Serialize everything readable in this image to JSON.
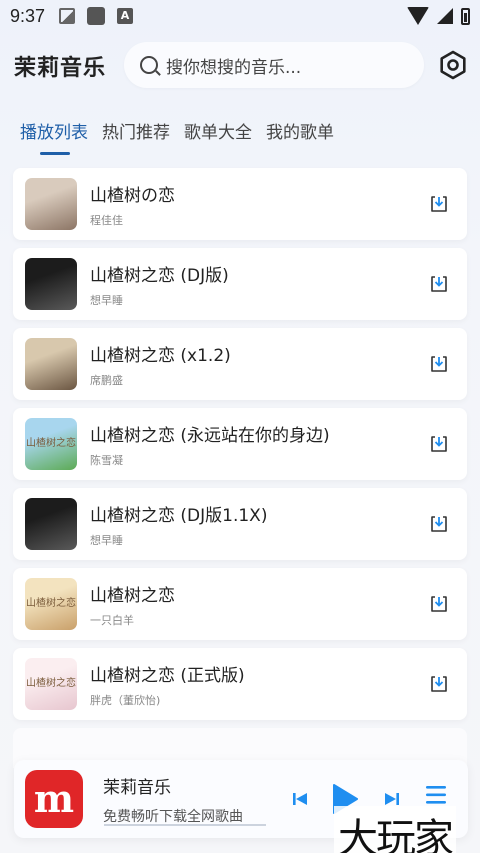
{
  "status_bar": {
    "time": "9:37",
    "notification_letter": "A"
  },
  "header": {
    "app_title": "茉莉音乐",
    "search_placeholder": "搜你想搜的音乐..."
  },
  "tabs": [
    {
      "label": "播放列表",
      "active": true
    },
    {
      "label": "热门推荐",
      "active": false
    },
    {
      "label": "歌单大全",
      "active": false
    },
    {
      "label": "我的歌单",
      "active": false
    }
  ],
  "songs": [
    {
      "title": "山楂树の恋",
      "artist": "程佳佳",
      "cover_colors": [
        "#d9cbbd",
        "#8c7565"
      ],
      "cover_text": ""
    },
    {
      "title": "山楂树之恋 (DJ版)",
      "artist": "想早睡",
      "cover_colors": [
        "#1c1c1c",
        "#5a5a5a"
      ],
      "cover_text": ""
    },
    {
      "title": "山楂树之恋 (x1.2)",
      "artist": "席鹏盛",
      "cover_colors": [
        "#d8c8ad",
        "#6b5642"
      ],
      "cover_text": ""
    },
    {
      "title": "山楂树之恋 (永远站在你的身边)",
      "artist": "陈雪凝",
      "cover_colors": [
        "#a8d6ee",
        "#5caa54"
      ],
      "cover_text": "山楂树之恋"
    },
    {
      "title": "山楂树之恋 (DJ版1.1X)",
      "artist": "想早睡",
      "cover_colors": [
        "#1c1c1c",
        "#5a5a5a"
      ],
      "cover_text": ""
    },
    {
      "title": "山楂树之恋",
      "artist": "一只白羊",
      "cover_colors": [
        "#f3e3bf",
        "#c9a06a"
      ],
      "cover_text": "山楂树之恋"
    },
    {
      "title": "山楂树之恋 (正式版)",
      "artist": "胖虎（董欣怡)",
      "cover_colors": [
        "#fbeef0",
        "#e7c6cf"
      ],
      "cover_text": "山楂树之恋"
    }
  ],
  "player": {
    "title": "茉莉音乐",
    "subtitle": "免费畅听下载全网歌曲",
    "progress": 0.0,
    "logo_letter": "m"
  },
  "watermark": "大玩家",
  "colors": {
    "accent": "#1f5fa8",
    "play_blue": "#1f8ef0",
    "logo_red": "#e02628"
  }
}
